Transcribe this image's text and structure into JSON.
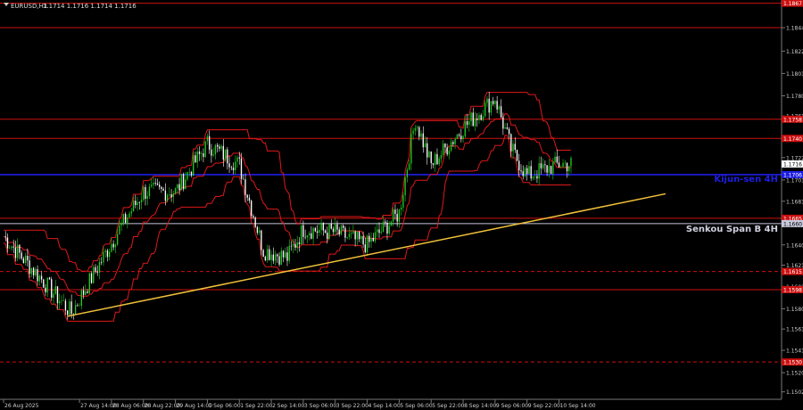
{
  "header": {
    "symbol": "EURUSD,H1",
    "quote": "1.1714 1.1716 1.1714 1.1716"
  },
  "labels": {
    "kijun": "Kijun-sen 4H",
    "senkou": "Senkou Span B 4H"
  },
  "chart_data": {
    "type": "candlestick",
    "ylim": [
      1.1495,
      1.187
    ],
    "y_ticks": [
      "1.1844",
      "1.1822",
      "1.1801",
      "1.1780",
      "1.1761",
      "1.1741",
      "1.1722",
      "1.1701",
      "1.1681",
      "1.1660",
      "1.1640",
      "1.1621",
      "1.1601",
      "1.1580",
      "1.1561",
      "1.1541",
      "1.1520",
      "1.1502"
    ],
    "x_ticks": [
      "26 Aug 2025",
      "27 Aug 14:00",
      "28 Aug 06:00",
      "28 Aug 22:00",
      "29 Aug 14:00",
      "1 Sep 06:00",
      "1 Sep 22:00",
      "2 Sep 14:00",
      "3 Sep 06:00",
      "3 Sep 22:00",
      "4 Sep 14:00",
      "5 Sep 06:00",
      "5 Sep 22:00",
      "8 Sep 14:00",
      "9 Sep 06:00",
      "9 Sep 22:00",
      "10 Sep 14:00"
    ],
    "current_price": "1.1716",
    "levels": [
      {
        "price": 1.1867,
        "label": "1.1867",
        "color": "#cc1010",
        "style": "solid"
      },
      {
        "price": 1.1844,
        "label": "",
        "color": "#cc1010",
        "style": "solid"
      },
      {
        "price": 1.1758,
        "label": "1.1758",
        "color": "#cc1010",
        "style": "solid"
      },
      {
        "price": 1.174,
        "label": "1.1740",
        "color": "#cc1010",
        "style": "solid"
      },
      {
        "price": 1.1706,
        "label": "1.1706",
        "color": "#1e1ee6",
        "style": "solid"
      },
      {
        "price": 1.1665,
        "label": "1.1665",
        "color": "#cc1010",
        "style": "solid"
      },
      {
        "price": 1.166,
        "label": "1.1660",
        "color": "#c8c8dc",
        "style": "solid"
      },
      {
        "price": 1.1615,
        "label": "1.1615",
        "color": "#cc1010",
        "style": "dashed"
      },
      {
        "price": 1.1598,
        "label": "1.1598",
        "color": "#cc1010",
        "style": "solid"
      },
      {
        "price": 1.153,
        "label": "1.1530",
        "color": "#cc1010",
        "style": "dashed"
      }
    ],
    "trendline": {
      "from": [
        "27 Aug 2025 08:00",
        1.1573
      ],
      "to": [
        "10 Sep 2025 22:00",
        1.1688
      ],
      "color": "#f2c23a"
    },
    "key_closes": [
      {
        "time": "26 Aug 00:00",
        "close": 1.1648
      },
      {
        "time": "27 Aug 10:00",
        "close": 1.1576
      },
      {
        "time": "28 Aug 10:00",
        "close": 1.1655
      },
      {
        "time": "28 Aug 22:00",
        "close": 1.169
      },
      {
        "time": "29 Aug 14:00",
        "close": 1.169
      },
      {
        "time": "1 Sep 06:00",
        "close": 1.1735
      },
      {
        "time": "1 Sep 22:00",
        "close": 1.1715
      },
      {
        "time": "2 Sep 10:00",
        "close": 1.1635
      },
      {
        "time": "2 Sep 22:00",
        "close": 1.1628
      },
      {
        "time": "3 Sep 06:00",
        "close": 1.1655
      },
      {
        "time": "3 Sep 22:00",
        "close": 1.1652
      },
      {
        "time": "4 Sep 14:00",
        "close": 1.164
      },
      {
        "time": "5 Sep 06:00",
        "close": 1.167
      },
      {
        "time": "5 Sep 14:00",
        "close": 1.1758
      },
      {
        "time": "5 Sep 22:00",
        "close": 1.1715
      },
      {
        "time": "8 Sep 14:00",
        "close": 1.175
      },
      {
        "time": "9 Sep 06:00",
        "close": 1.1778
      },
      {
        "time": "9 Sep 14:00",
        "close": 1.173
      },
      {
        "time": "9 Sep 22:00",
        "close": 1.1705
      },
      {
        "time": "10 Sep 14:00",
        "close": 1.1716
      }
    ],
    "colors": {
      "bull": "#22cc22",
      "bear": "#ffffff",
      "bands": "#e01818",
      "grid": "#2a2a2a"
    }
  }
}
